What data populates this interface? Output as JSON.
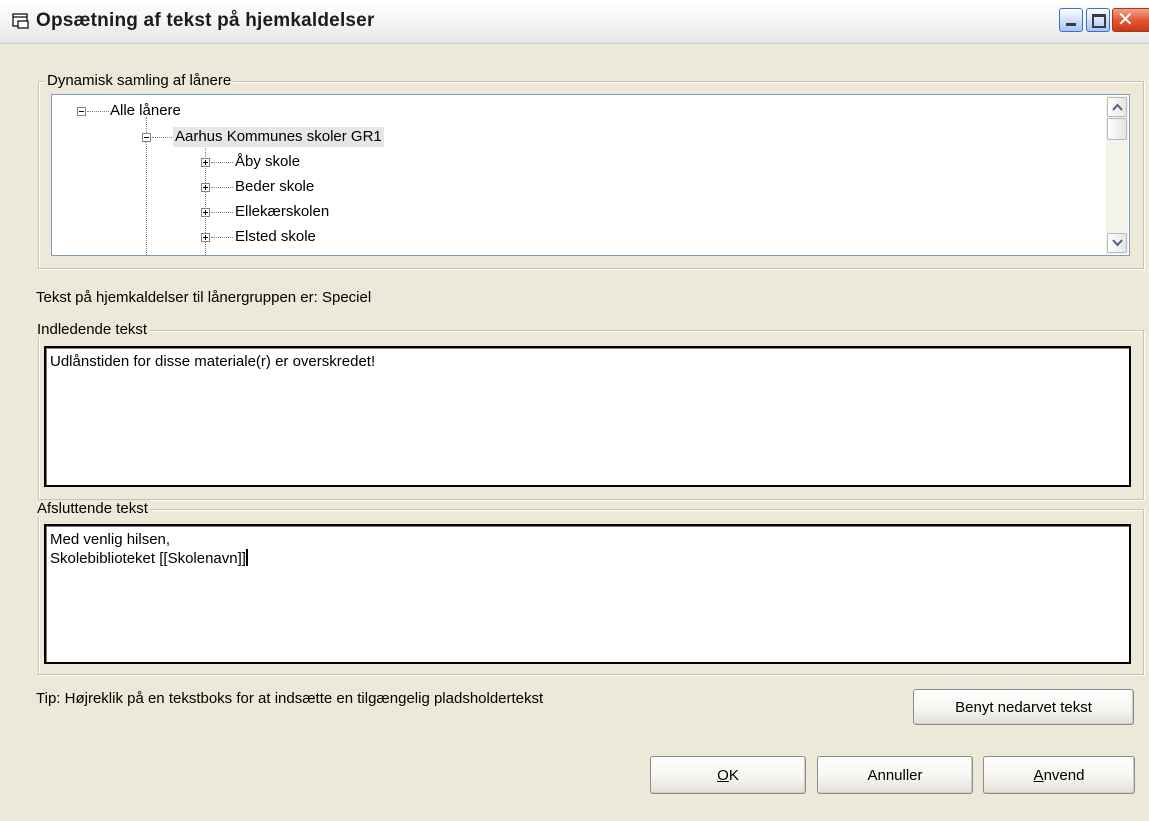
{
  "window": {
    "title": "Opsætning af tekst på hjemkaldelser",
    "icon": "dialog-app-icon",
    "controls": {
      "minimize": "minimize-icon",
      "maximize": "maximize-icon",
      "close": "close-icon"
    }
  },
  "dynamic_group": {
    "label": "Dynamisk samling af lånere",
    "tree": {
      "root": {
        "label": "Alle lånere",
        "expanded": true
      },
      "child": {
        "label": "Aarhus Kommunes skoler GR1",
        "expanded": true,
        "selected": true
      },
      "items": [
        {
          "label": "Åby skole",
          "expanded": false
        },
        {
          "label": "Beder skole",
          "expanded": false
        },
        {
          "label": "Ellekærskolen",
          "expanded": false
        },
        {
          "label": "Elsted skole",
          "expanded": false
        }
      ]
    }
  },
  "group_text": {
    "label": "Tekst på hjemkaldelser til lånergruppen er: Speciel"
  },
  "intro": {
    "label": "Indledende tekst",
    "value": "Udlånstiden for disse materiale(r) er overskredet!"
  },
  "closing": {
    "label": "Afsluttende tekst",
    "line1": "Med venlig hilsen,",
    "line2": "Skolebiblioteket [[Skolenavn]]"
  },
  "tip": {
    "text": "Tip: Højreklik på en tekstboks for at indsætte en tilgængelig pladsholdertekst"
  },
  "buttons": {
    "inherit": "Benyt nedarvet tekst",
    "ok_mnemonic": "O",
    "ok_rest": "K",
    "cancel": "Annuller",
    "apply_mnemonic": "A",
    "apply_rest": "nvend"
  }
}
